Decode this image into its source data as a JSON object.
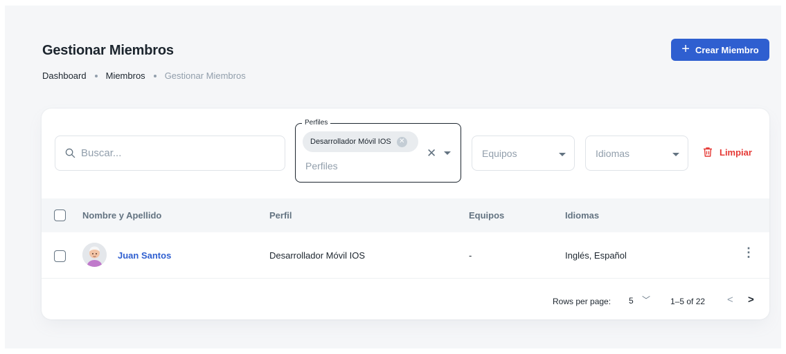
{
  "page": {
    "title": "Gestionar Miembros"
  },
  "breadcrumb": [
    "Dashboard",
    "Miembros",
    "Gestionar Miembros"
  ],
  "actions": {
    "create_label": "Crear Miembro"
  },
  "filters": {
    "search_placeholder": "Buscar...",
    "perfiles": {
      "legend": "Perfiles",
      "chip": "Desarrollador Móvil IOS",
      "placeholder": "Perfiles"
    },
    "equipos_placeholder": "Equipos",
    "idiomas_placeholder": "Idiomas",
    "clear_label": "Limpiar"
  },
  "table": {
    "headers": [
      "Nombre y Apellido",
      "Perfil",
      "Equipos",
      "Idiomas"
    ],
    "rows": [
      {
        "name": "Juan Santos",
        "perfil": "Desarrollador Móvil IOS",
        "equipos": "-",
        "idiomas": "Inglés, Español"
      }
    ]
  },
  "pagination": {
    "rows_label": "Rows per page:",
    "rows_value": "5",
    "range": "1–5 of 22"
  },
  "colors": {
    "primary": "#2f5fd0",
    "danger": "#e53935",
    "header_bg": "#f4f6f8"
  }
}
